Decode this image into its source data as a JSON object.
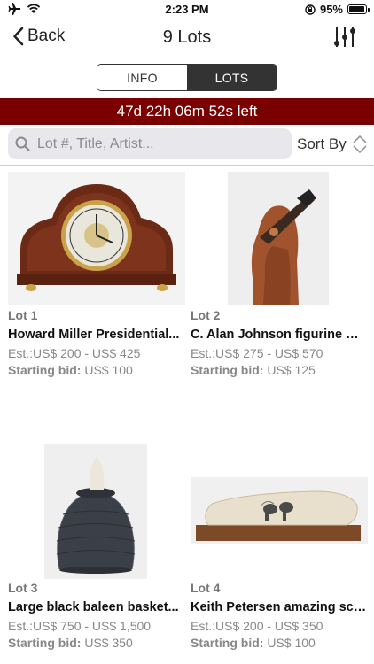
{
  "status_bar": {
    "time": "2:23 PM",
    "battery": "95%",
    "battery_level": 0.95
  },
  "nav": {
    "back_label": "Back",
    "title": "9 Lots"
  },
  "segments": {
    "info": "INFO",
    "lots": "LOTS",
    "selected": "LOTS"
  },
  "countdown": "47d 22h 06m 52s left",
  "search": {
    "placeholder": "Lot #, Title, Artist...",
    "value": ""
  },
  "sort_label": "Sort By",
  "starting_bid_label": "Starting bid:",
  "lots": [
    {
      "lot": "Lot 1",
      "title": "Howard Miller Presidential...",
      "estimate": "Est.:US$ 200 - US$ 425",
      "starting_bid": "US$ 100"
    },
    {
      "lot": "Lot 2",
      "title": "C. Alan Johnson figurine m...",
      "estimate": "Est.:US$ 275 - US$ 570",
      "starting_bid": "US$ 125"
    },
    {
      "lot": "Lot 3",
      "title": "Large black baleen basket...",
      "estimate": "Est.:US$ 750 - US$ 1,500",
      "starting_bid": "US$ 350"
    },
    {
      "lot": "Lot 4",
      "title": "Keith Petersen amazing scr...",
      "estimate": "Est.:US$ 200 - US$ 350",
      "starting_bid": "US$ 100"
    }
  ]
}
